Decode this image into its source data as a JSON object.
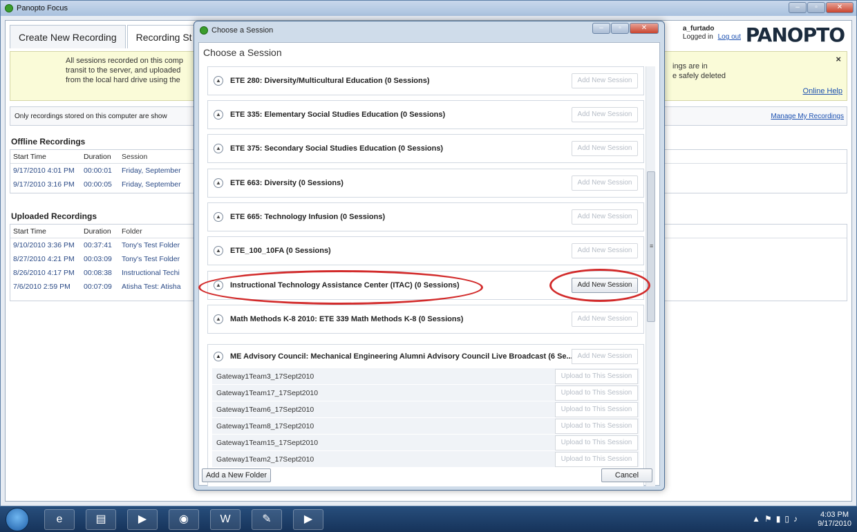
{
  "app": {
    "title": "Panopto Focus",
    "tabs": [
      {
        "label": "Create New Recording"
      },
      {
        "label": "Recording St"
      }
    ],
    "user": {
      "name": "a_furtado",
      "status": "Logged in",
      "logout": "Log out"
    },
    "brand": "PANOPTO",
    "info": {
      "lines": [
        "All sessions recorded on this comp",
        "transit to the server, and uploaded",
        "from the local hard drive using the"
      ],
      "right_lines": [
        "ings are in",
        "e safely deleted"
      ],
      "close": "×",
      "help": "Online Help"
    },
    "note": "Only recordings stored on this computer are show",
    "manage_link": "Manage My Recordings",
    "offline": {
      "title": "Offline Recordings",
      "headers": [
        "Start Time",
        "Duration",
        "Session"
      ],
      "rows": [
        [
          "9/17/2010 4:01 PM",
          "00:00:01",
          "Friday, September"
        ],
        [
          "9/17/2010 3:16 PM",
          "00:00:05",
          "Friday, September"
        ]
      ]
    },
    "uploaded": {
      "title": "Uploaded Recordings",
      "headers": [
        "Start Time",
        "Duration",
        "Folder"
      ],
      "rows": [
        [
          "9/10/2010 3:36 PM",
          "00:37:41",
          "Tony's Test Folder"
        ],
        [
          "8/27/2010 4:21 PM",
          "00:03:09",
          "Tony's Test Folder"
        ],
        [
          "8/26/2010 4:17 PM",
          "00:08:38",
          "Instructional Techi"
        ],
        [
          "7/6/2010 2:59 PM",
          "00:07:09",
          "Atisha Test: Atisha"
        ]
      ]
    }
  },
  "dialog": {
    "title": "Choose a Session",
    "heading": "Choose a Session",
    "folders": [
      {
        "name": "ETE 280: Diversity/Multicultural Education (0 Sessions)",
        "button": "Add New Session"
      },
      {
        "name": "ETE 335: Elementary Social Studies Education (0 Sessions)",
        "button": "Add New Session"
      },
      {
        "name": "ETE 375: Secondary Social Studies Education (0 Sessions)",
        "button": "Add New Session"
      },
      {
        "name": "ETE 663: Diversity (0 Sessions)",
        "button": "Add New Session"
      },
      {
        "name": "ETE 665: Technology Infusion (0 Sessions)",
        "button": "Add New Session"
      },
      {
        "name": "ETE_100_10FA (0 Sessions)",
        "button": "Add New Session"
      },
      {
        "name": "Instructional Technology Assistance Center (ITAC) (0 Sessions)",
        "button": "Add New Session"
      },
      {
        "name": "Math Methods K-8 2010: ETE 339 Math Methods K-8 (0 Sessions)",
        "button": "Add New Session"
      }
    ],
    "expanded": {
      "name": "ME Advisory Council: Mechanical Engineering Alumni Advisory Council Live Broadcast (6 Se...",
      "button": "Add New Session",
      "sessions": [
        "Gateway1Team3_17Sept2010",
        "Gateway1Team17_17Sept2010",
        "Gateway1Team6_17Sept2010",
        "Gateway1Team8_17Sept2010",
        "Gateway1Team15_17Sept2010",
        "Gateway1Team2_17Sept2010"
      ],
      "session_button": "Upload to This Session"
    },
    "add_folder": "Add a New Folder",
    "cancel": "Cancel"
  },
  "taskbar": {
    "time": "4:03 PM",
    "date": "9/17/2010"
  }
}
